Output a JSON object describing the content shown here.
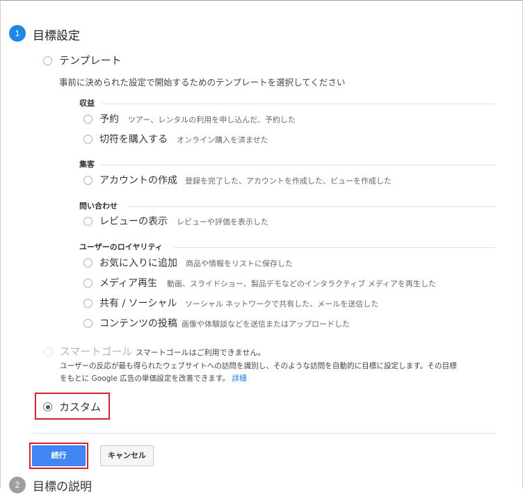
{
  "colors": {
    "accent": "#1a73e8",
    "step_active": "#1e88e5",
    "step_inactive": "#9e9e9e",
    "highlight": "#d8202a",
    "primary_button": "#4285f4"
  },
  "step1": {
    "number": "1",
    "title": "目標設定"
  },
  "template": {
    "label": "テンプレート",
    "description": "事前に決められた設定で開始するためのテンプレートを選択してください",
    "categories": [
      {
        "name": "収益",
        "options": [
          {
            "label": "予約",
            "desc": "ツアー、レンタルの利用を申し込んだ、予約した"
          },
          {
            "label": "切符を購入する",
            "desc": "オンライン購入を済ませた"
          }
        ]
      },
      {
        "name": "集客",
        "options": [
          {
            "label": "アカウントの作成",
            "desc": "登録を完了した、アカウントを作成した、ビューを作成した"
          }
        ]
      },
      {
        "name": "問い合わせ",
        "options": [
          {
            "label": "レビューの表示",
            "desc": "レビューや評価を表示した"
          }
        ]
      },
      {
        "name": "ユーザーのロイヤリティ",
        "options": [
          {
            "label": "お気に入りに追加",
            "desc": "商品や情報をリストに保存した"
          },
          {
            "label": "メディア再生",
            "desc": "動画、スライドショー、製品デモなどのインタラクティブ メディアを再生した"
          },
          {
            "label": "共有 / ソーシャル",
            "desc": "ソーシャル ネットワークで共有した、メールを送信した"
          },
          {
            "label": "コンテンツの投稿",
            "desc": "画像や体験談などを送信またはアップロードした"
          }
        ]
      }
    ]
  },
  "smart_goal": {
    "label": "スマートゴール",
    "unavailable": "スマートゴールはご利用できません。",
    "note_line1": "ユーザーの反応が最も得られたウェブサイトへの訪問を識別し、そのような訪問を自動的に目標に設定します。その目標",
    "note_line2": "をもとに Google 広告の単価設定を改善できます。",
    "details_link": "詳細"
  },
  "custom": {
    "label": "カスタム",
    "checked": true
  },
  "buttons": {
    "continue": "続行",
    "cancel": "キャンセル"
  },
  "step2": {
    "number": "2",
    "title": "目標の説明"
  }
}
